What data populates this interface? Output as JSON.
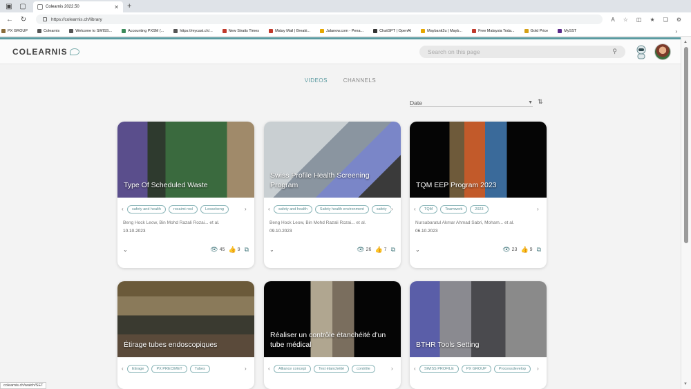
{
  "browser": {
    "tab_title": "Colearnis 2022.50",
    "url": "https://colearnis.ch/library",
    "bookmarks": [
      "PX GROUP",
      "Colearnis",
      "Welcome to SWISS...",
      "Accounting PXSM (...",
      "https://mycast.ch/...",
      "New Straits Times",
      "Malay Mail | Breaki...",
      "Jalanow.com - Pena...",
      "ChatGPT | OpenAI",
      "Maybank2u | Mayb...",
      "Free Malaysia Toda...",
      "Gold Price",
      "MySST"
    ]
  },
  "header": {
    "logo": "COLEARNIS",
    "search_placeholder": "Search on this page"
  },
  "tabs": [
    "VIDEOS",
    "CHANNELS"
  ],
  "sort": {
    "label": "Date"
  },
  "cards": [
    {
      "title": "Type Of Scheduled Waste",
      "tags": [
        "safety and health",
        "rocaimi rosl",
        "Lessebeng"
      ],
      "authors": "Beng Hock Leow, Bin Mohd Razali Rozai... et al.",
      "date": "10.10.2023",
      "views": "45",
      "likes": "9"
    },
    {
      "title": "Swiss Profile Health Screening Program",
      "tags": [
        "safety and health",
        "Safety health environment",
        "safety"
      ],
      "authors": "Beng Hock Leow, Bin Mohd Razali Rozai... et al.",
      "date": "09.10.2023",
      "views": "26",
      "likes": "7"
    },
    {
      "title": "TQM EEP Program 2023",
      "tags": [
        "TQM",
        "Teamwork",
        "2023"
      ],
      "authors": "Nursabaratul Akmar Ahmad Sabri, Moham... et al.",
      "date": "06.10.2023",
      "views": "23",
      "likes": "9"
    },
    {
      "title": "Étirage tubes endoscopiques",
      "tags": [
        "Etirage",
        "PX PRECIMET",
        "Tubes"
      ]
    },
    {
      "title": "Réaliser un contrôle étanchéité d'un tube médical",
      "tags": [
        "Alliance concept",
        "Test étanchéité",
        "contrôle"
      ]
    },
    {
      "title": "BTHR Tools Setting",
      "tags": [
        "SWISS PROFILE",
        "PX GROUP",
        "Processdevelop"
      ]
    }
  ],
  "status_bar": "colearnis.ch/watch/SET",
  "colors": {
    "accent": "#5a9aa0",
    "tag_border": "#8bb6b9"
  },
  "icons": [
    "search-icon",
    "bot-icon",
    "avatar",
    "eye-icon",
    "thumbs-up-icon",
    "share-icon",
    "chevron-down-icon",
    "sort-icon"
  ]
}
